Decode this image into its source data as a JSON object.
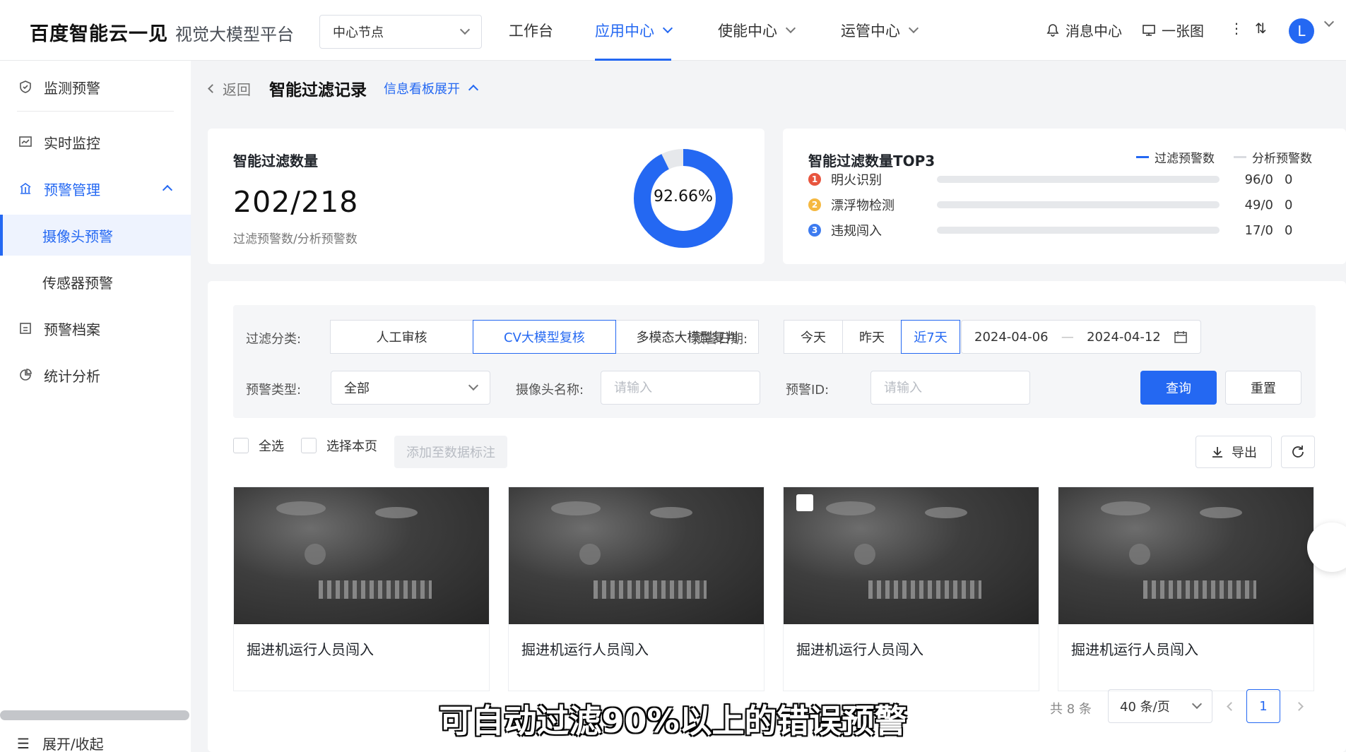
{
  "header": {
    "logo": "百度智能云一见",
    "platform": "视觉大模型平台",
    "node_select": "中心节点",
    "nav": [
      "工作台",
      "应用中心",
      "使能中心",
      "运管中心"
    ],
    "messages": "消息中心",
    "one_pic": "一张图",
    "avatar": "L"
  },
  "sidebar": {
    "items": [
      "监测预警",
      "实时监控",
      "预警管理",
      "摄像头预警",
      "传感器预警",
      "预警档案",
      "统计分析"
    ],
    "footer": "展开/收起"
  },
  "breadcrumb": {
    "back": "返回",
    "title": "智能过滤记录",
    "toggle": "信息看板展开"
  },
  "stats": {
    "title": "智能过滤数量",
    "value": "202/218",
    "label": "过滤预警数/分析预警数",
    "percent_text": "92.66%",
    "percent": 0.9266
  },
  "top3": {
    "title": "智能过滤数量TOP3",
    "legend": [
      "过滤预警数",
      "分析预警数"
    ],
    "colors": [
      "#2468f2",
      "#d9dbe0"
    ],
    "rows": [
      {
        "rank": "1",
        "name": "明火识别",
        "val": "96/0",
        "val2": "0",
        "color": "#e8553e",
        "ratio": 0
      },
      {
        "rank": "2",
        "name": "漂浮物检测",
        "val": "49/0",
        "val2": "0",
        "color": "#f5b840",
        "ratio": 0
      },
      {
        "rank": "3",
        "name": "违规闯入",
        "val": "17/0",
        "val2": "0",
        "color": "#3d7bf0",
        "ratio": 0
      }
    ]
  },
  "filters": {
    "category_label": "过滤分类:",
    "category_options": [
      "人工审核",
      "CV大模型复核",
      "多模态大模型复判"
    ],
    "date_label": "预警日期:",
    "date_options": [
      "今天",
      "昨天",
      "近7天"
    ],
    "date_start": "2024-04-06",
    "date_sep": "—",
    "date_end": "2024-04-12",
    "type_label": "预警类型:",
    "type_value": "全部",
    "camera_label": "摄像头名称:",
    "camera_placeholder": "请输入",
    "id_label": "预警ID:",
    "id_placeholder": "请输入",
    "query": "查询",
    "reset": "重置"
  },
  "toolbar": {
    "select_all": "全选",
    "select_page": "选择本页",
    "add_label": "添加至数据标注",
    "export": "导出"
  },
  "cards": [
    {
      "title": "掘进机运行人员闯入"
    },
    {
      "title": "掘进机运行人员闯入"
    },
    {
      "title": "掘进机运行人员闯入"
    },
    {
      "title": "掘进机运行人员闯入"
    }
  ],
  "pagination": {
    "total": "共 8 条",
    "page_size": "40 条/页",
    "page": "1"
  },
  "caption": "可自动过滤90%以上的错误预警"
}
